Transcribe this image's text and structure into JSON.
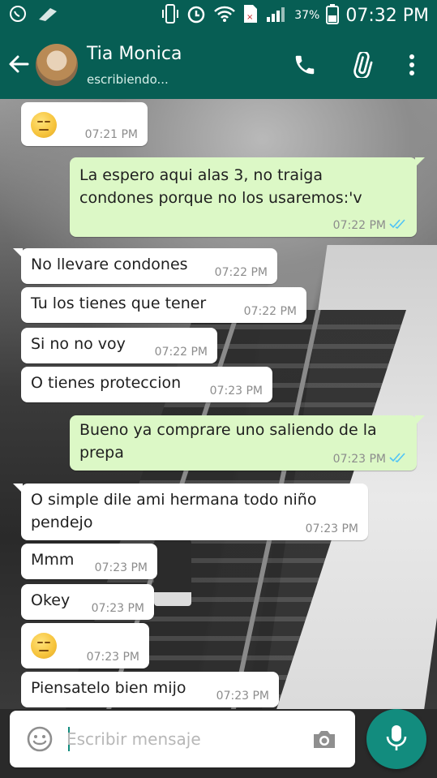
{
  "status_bar": {
    "battery_percent": "37%",
    "time": "07:32 PM"
  },
  "header": {
    "contact_name": "Tia Monica",
    "contact_status": "escribiendo..."
  },
  "messages": [
    {
      "direction": "in",
      "emoji": "unamused-face",
      "text": "",
      "time": "07:21 PM"
    },
    {
      "direction": "out",
      "text": "La espero aqui alas 3, no traiga\ncondones porque no los usaremos:'v",
      "time": "07:22 PM",
      "status": "read"
    },
    {
      "direction": "in",
      "text": "No llevare condones",
      "time": "07:22 PM"
    },
    {
      "direction": "in",
      "text": "Tu los tienes que tener",
      "time": "07:22 PM"
    },
    {
      "direction": "in",
      "text": "Si no no voy",
      "time": "07:22 PM"
    },
    {
      "direction": "in",
      "text": "O tienes proteccion",
      "time": "07:23 PM"
    },
    {
      "direction": "out",
      "text": "Bueno ya comprare uno saliendo de la\nprepa",
      "time": "07:23 PM",
      "status": "read"
    },
    {
      "direction": "in",
      "text": "O simple dile ami hermana todo niño\npendejo",
      "time": "07:23 PM"
    },
    {
      "direction": "in",
      "text": "Mmm",
      "time": "07:23 PM"
    },
    {
      "direction": "in",
      "text": "Okey",
      "time": "07:23 PM"
    },
    {
      "direction": "in",
      "emoji": "unamused-face",
      "text": "",
      "time": "07:23 PM"
    },
    {
      "direction": "in",
      "text": "Piensatelo bien mijo",
      "time": "07:23 PM"
    }
  ],
  "composer": {
    "placeholder": "Escribir mensaje"
  },
  "colors": {
    "header": "#075e54",
    "accent": "#128c7e",
    "outgoing_bubble": "#dcf8c6",
    "incoming_bubble": "#ffffff",
    "read_ticks": "#4fc3f7"
  },
  "icons": {
    "status_left": [
      "whatsapp-icon",
      "notification-icon"
    ],
    "status_right": [
      "vibrate-icon",
      "alarm-icon",
      "wifi-icon",
      "sim-icon",
      "signal-icon",
      "battery-icon"
    ],
    "header_actions": [
      "back-arrow-icon",
      "phone-icon",
      "paperclip-icon",
      "more-vert-icon"
    ],
    "composer": [
      "emoji-icon",
      "camera-icon",
      "mic-icon"
    ]
  }
}
